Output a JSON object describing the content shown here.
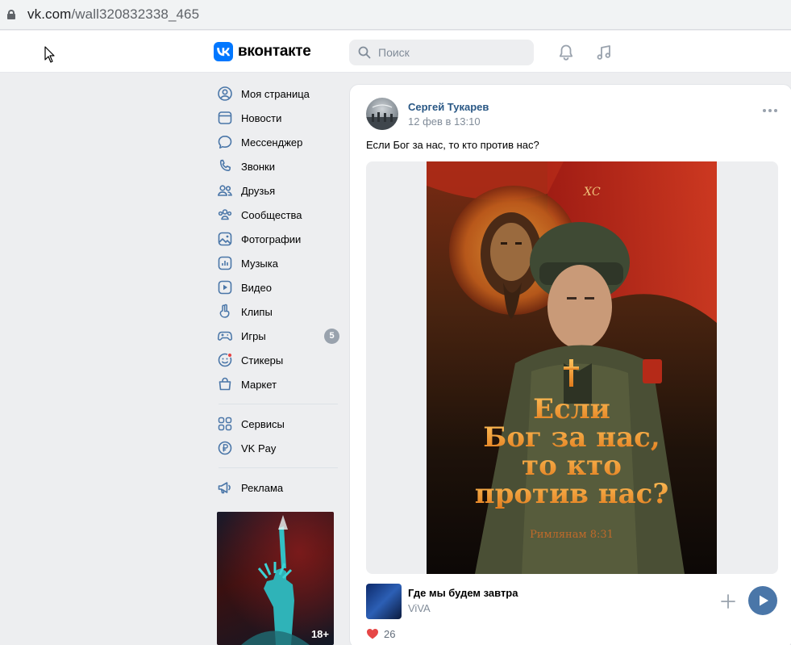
{
  "browser": {
    "url_host": "vk.com",
    "url_path": "/wall320832338_465"
  },
  "header": {
    "logo_text": "вконтакте",
    "search_placeholder": "Поиск",
    "icons": [
      "bell-icon",
      "music-note-icon"
    ]
  },
  "sidebar": {
    "items": [
      {
        "label": "Моя страница",
        "icon": "user-circle-icon"
      },
      {
        "label": "Новости",
        "icon": "newsfeed-icon"
      },
      {
        "label": "Мессенджер",
        "icon": "message-icon"
      },
      {
        "label": "Звонки",
        "icon": "phone-icon"
      },
      {
        "label": "Друзья",
        "icon": "friends-icon"
      },
      {
        "label": "Сообщества",
        "icon": "communities-icon"
      },
      {
        "label": "Фотографии",
        "icon": "photos-icon"
      },
      {
        "label": "Музыка",
        "icon": "music-icon"
      },
      {
        "label": "Видео",
        "icon": "video-icon"
      },
      {
        "label": "Клипы",
        "icon": "clips-icon"
      },
      {
        "label": "Игры",
        "icon": "games-icon",
        "badge": "5"
      },
      {
        "label": "Стикеры",
        "icon": "stickers-icon"
      },
      {
        "label": "Маркет",
        "icon": "market-icon"
      }
    ],
    "secondary": [
      {
        "label": "Сервисы",
        "icon": "services-icon"
      },
      {
        "label": "VK Pay",
        "icon": "vkpay-icon"
      }
    ],
    "ads": {
      "label": "Реклама",
      "icon": "megaphone-icon"
    },
    "ad_banner_age": "18+"
  },
  "post": {
    "author": "Сергей Тукарев",
    "date": "12 фев в 13:10",
    "text": "Если Бог за нас, то кто против нас?",
    "image": {
      "banner_text": "ХС",
      "caption_lines": [
        "Если",
        "Бог за нас,",
        "то кто",
        "против нас?"
      ],
      "reference": "Римлянам 8:31"
    },
    "audio": {
      "title": "Где мы будем завтра",
      "artist": "ViVA"
    },
    "likes_count": "26"
  },
  "colors": {
    "vk_blue": "#0077ff",
    "link": "#2a5885",
    "muted": "#818c99",
    "play_button": "#4a76a8",
    "like_red": "#e64646",
    "background": "#edeef0"
  }
}
